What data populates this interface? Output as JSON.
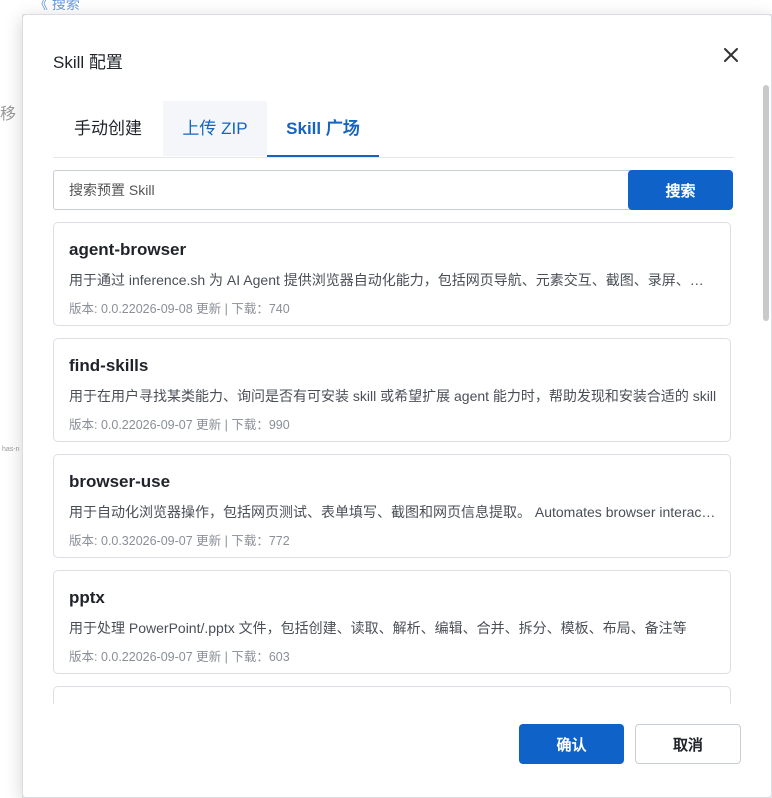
{
  "background": {
    "back_label": "《 搜索",
    "fragment_text": "移",
    "small_text": "has-n"
  },
  "modal": {
    "title": "Skill 配置",
    "close_icon": "close-icon"
  },
  "tabs": [
    {
      "label": "手动创建"
    },
    {
      "label": "上传 ZIP"
    },
    {
      "label": "Skill 广场"
    }
  ],
  "active_tab": "Skill 广场",
  "search": {
    "placeholder": "搜索预置 Skill",
    "button_label": "搜索"
  },
  "skills": [
    {
      "name": "agent-browser",
      "description": "用于通过 inference.sh 为 AI Agent 提供浏览器自动化能力，包括网页导航、元素交互、截图、录屏、表单填写等",
      "meta": "版本: 0.0.22026-09-08 更新 | 下载：740"
    },
    {
      "name": "find-skills",
      "description": "用于在用户寻找某类能力、询问是否有可安装 skill 或希望扩展 agent 能力时，帮助发现和安装合适的 skill",
      "meta": "版本: 0.0.22026-09-07 更新 | 下载：990"
    },
    {
      "name": "browser-use",
      "description": "用于自动化浏览器操作，包括网页测试、表单填写、截图和网页信息提取。 Automates browser interactions",
      "meta": "版本: 0.0.32026-09-07 更新 | 下载：772"
    },
    {
      "name": "pptx",
      "description": "用于处理 PowerPoint/.pptx 文件，包括创建、读取、解析、编辑、合并、拆分、模板、布局、备注等",
      "meta": "版本: 0.0.22026-09-07 更新 | 下载：603"
    }
  ],
  "footer": {
    "confirm_label": "确认",
    "cancel_label": "取消"
  },
  "colors": {
    "primary": "#0f62c8",
    "active_tab": "#1565c0"
  }
}
